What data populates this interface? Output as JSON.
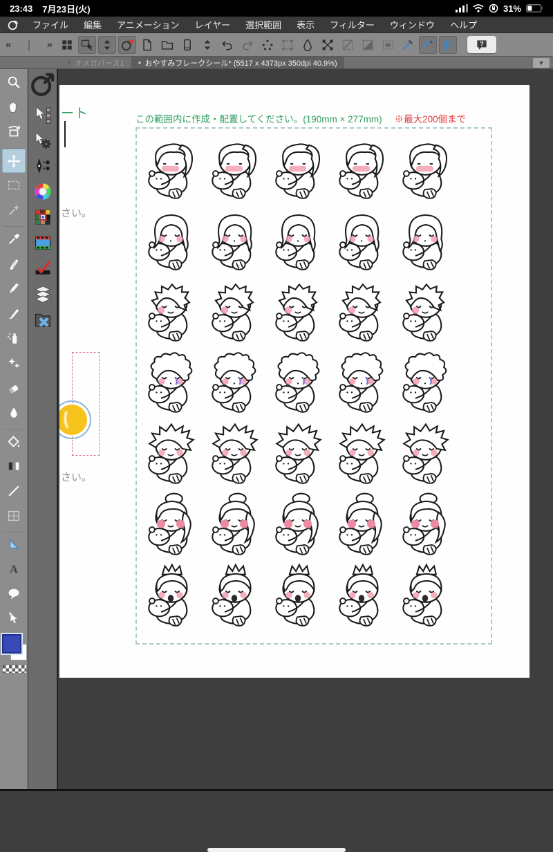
{
  "status_bar": {
    "time": "23:43",
    "date": "7月23日(火)",
    "battery_percent": "31%",
    "icons": [
      "cellular-signal-icon",
      "wifi-icon",
      "rotation-lock-icon",
      "battery-icon"
    ]
  },
  "menu_bar": {
    "logo": "clip-studio-logo-icon",
    "items": [
      "ファイル",
      "編集",
      "アニメーション",
      "レイヤー",
      "選択範囲",
      "表示",
      "フィルター",
      "ウィンドウ",
      "ヘルプ"
    ]
  },
  "toolbar": {
    "collapse": {
      "left": "«",
      "bar": "❘",
      "right": "»"
    },
    "items": [
      {
        "name": "workspace-grid-icon",
        "icon": "grid"
      },
      {
        "name": "touch-gesture-icon",
        "icon": "gesture",
        "pressed": true
      },
      {
        "name": "size-spinner-icon",
        "icon": "spinner",
        "pressed": true
      },
      {
        "name": "clip-studio-app-icon",
        "icon": "csplogo",
        "pressed": true
      },
      {
        "name": "new-canvas-icon",
        "icon": "newdoc"
      },
      {
        "name": "open-file-icon",
        "icon": "folder"
      },
      {
        "name": "device-canvas-icon",
        "icon": "device"
      },
      {
        "name": "device-spinner-icon",
        "icon": "spinner"
      },
      {
        "name": "undo-icon",
        "icon": "undo"
      },
      {
        "name": "redo-icon",
        "icon": "redo",
        "dim": true
      },
      {
        "name": "scatter-move-icon",
        "icon": "scatter"
      },
      {
        "name": "transform-icon",
        "icon": "transform",
        "dim": true
      },
      {
        "name": "blend-drop-icon",
        "icon": "drop"
      },
      {
        "name": "mesh-transform-icon",
        "icon": "mesh"
      },
      {
        "name": "deselect-icon",
        "icon": "deselect",
        "dim": true
      },
      {
        "name": "invert-selection-icon",
        "icon": "invertsel",
        "dim": true
      },
      {
        "name": "selection-launcher-icon",
        "icon": "selstrip",
        "dim": true
      },
      {
        "name": "line-ruler-icon",
        "icon": "linetool"
      },
      {
        "name": "curve-ruler-icon",
        "icon": "curvetool",
        "pressed": true
      },
      {
        "name": "symmetry-ruler-icon",
        "icon": "symtool",
        "pressed": true
      },
      {
        "name": "help-icon",
        "icon": "help",
        "help": true
      }
    ]
  },
  "tab_bar": {
    "tabs": [
      {
        "label": "オメガバース1",
        "state": "inactive",
        "glyph": "×",
        "glyph_name": "close-icon"
      },
      {
        "label": "おやすみフレークシール* (5517 x 4373px 350dpi 40.9%)",
        "state": "active",
        "glyph": "●",
        "glyph_name": "modified-dot-icon"
      }
    ],
    "dropdown_glyph": "▼"
  },
  "tool_column": {
    "tools": [
      {
        "name": "zoom-tool",
        "icon": "zoomtool"
      },
      {
        "name": "hand-tool",
        "icon": "handtool"
      },
      {
        "name": "rotate-canvas-tool",
        "icon": "rotatetool"
      },
      {
        "name": "move-layer-tool",
        "icon": "movetool",
        "selected": true,
        "sep": true
      },
      {
        "name": "marquee-select-tool",
        "icon": "marquee",
        "dim": true
      },
      {
        "name": "magic-wand-tool",
        "icon": "wand",
        "dim": true
      },
      {
        "name": "eyedropper-tool",
        "icon": "eyedropper",
        "sep": true
      },
      {
        "name": "pen-tool",
        "icon": "pentool"
      },
      {
        "name": "pencil-tool",
        "icon": "penciltool"
      },
      {
        "name": "brush-tool",
        "icon": "brushtool"
      },
      {
        "name": "airbrush-tool",
        "icon": "airbrush"
      },
      {
        "name": "decoration-tool",
        "icon": "decoration"
      },
      {
        "name": "eraser-tool",
        "icon": "erasertool"
      },
      {
        "name": "blend-tool",
        "icon": "blendtool"
      },
      {
        "name": "fill-tool",
        "icon": "filltool",
        "sep": true
      },
      {
        "name": "gradient-tool",
        "icon": "gradienttool"
      },
      {
        "name": "figure-tool",
        "icon": "figuretool"
      },
      {
        "name": "frame-border-tool",
        "icon": "frametool",
        "dim": true
      },
      {
        "name": "operation-tool",
        "icon": "operationtool",
        "sep": true
      },
      {
        "name": "text-tool",
        "icon": "texttool"
      },
      {
        "name": "balloon-tool",
        "icon": "balloontool"
      },
      {
        "name": "correct-line-tool",
        "icon": "vectortool"
      }
    ],
    "foreground_color": "#3a49b8",
    "background_color": "#ffffff"
  },
  "quick_column": {
    "items": [
      {
        "name": "launcher-icon",
        "icon": "launcher",
        "launcher": true
      },
      {
        "name": "auto-action-icon",
        "icon": "autoaction"
      },
      {
        "name": "tool-property-icon",
        "icon": "toolprop"
      },
      {
        "name": "sub-tool-icon",
        "icon": "subtool"
      },
      {
        "name": "color-wheel-icon",
        "icon": "colorwheel"
      },
      {
        "name": "color-set-icon",
        "icon": "colorset"
      },
      {
        "name": "timeline-icon",
        "icon": "timeline"
      },
      {
        "name": "correction-icon",
        "icon": "correction"
      },
      {
        "name": "layer-panel-icon",
        "icon": "layerspanel"
      },
      {
        "name": "material-panel-icon",
        "icon": "materialpanel"
      }
    ]
  },
  "page": {
    "partial_heading": "ート",
    "instruction": "この範囲内に作成・配置してください。(190mm × 277mm)",
    "limit_note": "※最大200個まで",
    "partial_text_1": "さい。",
    "partial_text_2": "さい。",
    "grid_rows": 7,
    "grid_cols": 5,
    "characters": [
      {
        "name": "sticker-ponytail-sleeper",
        "hair": "ponytail",
        "eyes": "dots",
        "blush": "patch",
        "mouth": "none"
      },
      {
        "name": "sticker-long-hair-sleeper",
        "hair": "long",
        "eyes": "closed",
        "blush": "circles",
        "mouth": "dot"
      },
      {
        "name": "sticker-messy-short-sleeper",
        "hair": "messy",
        "eyes": "closed",
        "blush": "single",
        "mouth": "smile"
      },
      {
        "name": "sticker-curly-teary-sleeper",
        "hair": "curly",
        "eyes": "closed",
        "blush": "circles",
        "mouth": "dot",
        "tear": true
      },
      {
        "name": "sticker-spiky-swept-sleeper",
        "hair": "spiky",
        "eyes": "closed",
        "blush": "circles",
        "mouth": "smile"
      },
      {
        "name": "sticker-bun-updo-sleeper",
        "hair": "bun",
        "eyes": "closed",
        "blush": "big",
        "mouth": "smile"
      },
      {
        "name": "sticker-tuft-yawning-sleeper",
        "hair": "tuft",
        "eyes": "closed",
        "blush": "circles",
        "mouth": "yawn"
      }
    ]
  },
  "colors": {
    "instruction_green": "#2f9e5f",
    "limit_red": "#e03a3a",
    "dash_teal": "#a9cbc9",
    "dash_pink": "#e0718a",
    "blush_pink": "#f2a0b2",
    "blush_big_pink": "#ef8aa4",
    "tear_blue": "#7b7ce0",
    "accent_blue": "#3f86c9",
    "yellow_blob": "#f6c31c",
    "blob_ring_blue": "#8ab6d6",
    "line_art": "#1a1a1a"
  }
}
